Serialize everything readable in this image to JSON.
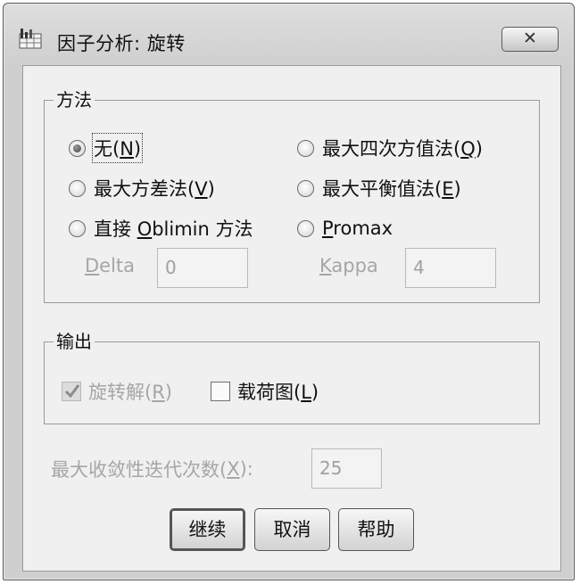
{
  "window": {
    "title": "因子分析: 旋转",
    "close_glyph": "✕"
  },
  "method": {
    "legend": "方法",
    "options": [
      {
        "pre": "无(",
        "key": "N",
        "post": ")",
        "selected": true
      },
      {
        "pre": "最大方差法(",
        "key": "V",
        "post": ")",
        "selected": false
      },
      {
        "pre": "直接 ",
        "key": "O",
        "post": "blimin 方法",
        "selected": false
      },
      {
        "pre": "最大四次方值法(",
        "key": "Q",
        "post": ")",
        "selected": false
      },
      {
        "pre": "最大平衡值法(",
        "key": "E",
        "post": ")",
        "selected": false
      },
      {
        "pre": "",
        "key": "P",
        "post": "romax",
        "selected": false
      }
    ],
    "delta": {
      "key": "D",
      "rest": "elta",
      "value": "0"
    },
    "kappa": {
      "key": "K",
      "rest": "appa",
      "value": "4"
    }
  },
  "output": {
    "legend": "输出",
    "rotated_solution": {
      "pre": "旋转解(",
      "key": "R",
      "post": ")",
      "checked": true,
      "enabled": false
    },
    "loading_plot": {
      "pre": "载荷图(",
      "key": "L",
      "post": ")",
      "checked": false,
      "enabled": true
    }
  },
  "max_iterations": {
    "pre": "最大收敛性迭代次数(",
    "key": "X",
    "post": "):",
    "value": "25"
  },
  "buttons": {
    "continue": "继续",
    "cancel": "取消",
    "help": "帮助"
  }
}
